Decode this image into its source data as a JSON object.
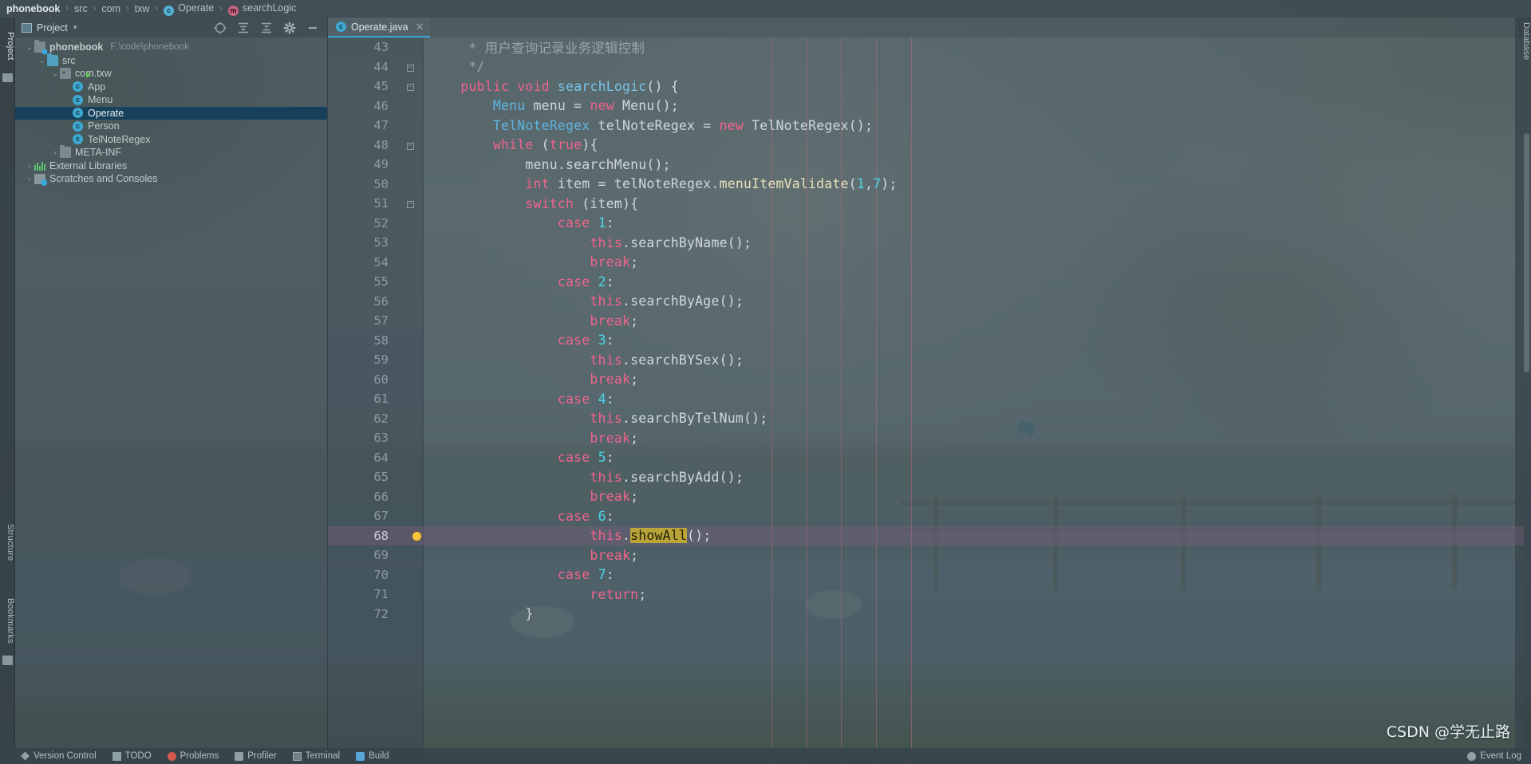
{
  "breadcrumb": {
    "items": [
      {
        "label": "phonebook",
        "icon": null,
        "bold": true
      },
      {
        "label": "src",
        "icon": null,
        "bold": false
      },
      {
        "label": "com",
        "icon": null,
        "bold": false
      },
      {
        "label": "txw",
        "icon": null,
        "bold": false
      },
      {
        "label": "Operate",
        "icon": "class-icon",
        "bold": false
      },
      {
        "label": "searchLogic",
        "icon": "method-icon",
        "bold": false
      }
    ],
    "separator": "›"
  },
  "left_strip": {
    "project_tab": "Project",
    "structure_tab": "Structure",
    "bookmarks_tab": "Bookmarks"
  },
  "right_strip": {
    "database_tab": "Database"
  },
  "project_panel": {
    "title": "Project",
    "caret": "▾",
    "toolbar": [
      {
        "name": "select-opened-file-icon",
        "glyph": "⊕"
      },
      {
        "name": "expand-all-icon",
        "glyph": "≡"
      },
      {
        "name": "collapse-all-icon",
        "glyph": "≡"
      },
      {
        "name": "settings-gear-icon",
        "glyph": "⚙"
      },
      {
        "name": "hide-panel-icon",
        "glyph": "−"
      }
    ],
    "tree": [
      {
        "label": "phonebook",
        "path": "F:\\code\\phonebook",
        "indent": 0,
        "arrow": "⌄",
        "icon": "module-folder",
        "selected": false
      },
      {
        "label": "src",
        "path": "",
        "indent": 1,
        "arrow": "⌄",
        "icon": "source-folder",
        "selected": false
      },
      {
        "label": "com.txw",
        "path": "",
        "indent": 2,
        "arrow": "⌄",
        "icon": "package",
        "selected": false
      },
      {
        "label": "App",
        "path": "",
        "indent": 3,
        "arrow": "",
        "icon": "class-runnable",
        "selected": false
      },
      {
        "label": "Menu",
        "path": "",
        "indent": 3,
        "arrow": "",
        "icon": "class",
        "selected": false
      },
      {
        "label": "Operate",
        "path": "",
        "indent": 3,
        "arrow": "",
        "icon": "class",
        "selected": true
      },
      {
        "label": "Person",
        "path": "",
        "indent": 3,
        "arrow": "",
        "icon": "class",
        "selected": false
      },
      {
        "label": "TelNoteRegex",
        "path": "",
        "indent": 3,
        "arrow": "",
        "icon": "class",
        "selected": false
      },
      {
        "label": "META-INF",
        "path": "",
        "indent": 2,
        "arrow": "›",
        "icon": "folder",
        "selected": false
      },
      {
        "label": "External Libraries",
        "path": "",
        "indent": 0,
        "arrow": "›",
        "icon": "libraries",
        "selected": false
      },
      {
        "label": "Scratches and Consoles",
        "path": "",
        "indent": 0,
        "arrow": "›",
        "icon": "scratches",
        "selected": false
      }
    ]
  },
  "editor": {
    "tab": {
      "label": "Operate.java",
      "icon": "class-icon",
      "close": "✕"
    },
    "lines": [
      {
        "n": 43,
        "fold": "",
        "bulb": false,
        "highlight": false,
        "tokens": [
          {
            "t": "   * 用户查询记录业务逻辑控制",
            "c": "cmt"
          }
        ]
      },
      {
        "n": 44,
        "fold": "box",
        "bulb": false,
        "highlight": false,
        "tokens": [
          {
            "t": "   */",
            "c": "cmt"
          }
        ]
      },
      {
        "n": 45,
        "fold": "boxend",
        "bulb": false,
        "highlight": false,
        "tokens": [
          {
            "t": "  ",
            "c": "pun"
          },
          {
            "t": "public",
            "c": "kw"
          },
          {
            "t": " ",
            "c": "pun"
          },
          {
            "t": "void",
            "c": "kw"
          },
          {
            "t": " ",
            "c": "pun"
          },
          {
            "t": "searchLogic",
            "c": "fn"
          },
          {
            "t": "() {",
            "c": "pun"
          }
        ]
      },
      {
        "n": 46,
        "fold": "",
        "bulb": false,
        "highlight": false,
        "tokens": [
          {
            "t": "      ",
            "c": "pun"
          },
          {
            "t": "Menu",
            "c": "type"
          },
          {
            "t": " menu = ",
            "c": "pun"
          },
          {
            "t": "new",
            "c": "kw"
          },
          {
            "t": " Menu();",
            "c": "pun"
          }
        ]
      },
      {
        "n": 47,
        "fold": "",
        "bulb": false,
        "highlight": false,
        "tokens": [
          {
            "t": "      ",
            "c": "pun"
          },
          {
            "t": "TelNoteRegex",
            "c": "type"
          },
          {
            "t": " telNoteRegex = ",
            "c": "pun"
          },
          {
            "t": "new",
            "c": "kw"
          },
          {
            "t": " TelNoteRegex();",
            "c": "pun"
          }
        ]
      },
      {
        "n": 48,
        "fold": "box",
        "bulb": false,
        "highlight": false,
        "tokens": [
          {
            "t": "      ",
            "c": "pun"
          },
          {
            "t": "while",
            "c": "kw"
          },
          {
            "t": " (",
            "c": "pun"
          },
          {
            "t": "true",
            "c": "kw"
          },
          {
            "t": "){",
            "c": "pun"
          }
        ]
      },
      {
        "n": 49,
        "fold": "",
        "bulb": false,
        "highlight": false,
        "tokens": [
          {
            "t": "          menu.searchMenu();",
            "c": "pun"
          }
        ]
      },
      {
        "n": 50,
        "fold": "",
        "bulb": false,
        "highlight": false,
        "tokens": [
          {
            "t": "          ",
            "c": "pun"
          },
          {
            "t": "int",
            "c": "kw"
          },
          {
            "t": " item = telNoteRegex.",
            "c": "pun"
          },
          {
            "t": "menuItemValidate",
            "c": "fncall"
          },
          {
            "t": "(",
            "c": "pun"
          },
          {
            "t": "1",
            "c": "num"
          },
          {
            "t": ",",
            "c": "pun"
          },
          {
            "t": "7",
            "c": "num"
          },
          {
            "t": ");",
            "c": "pun"
          }
        ]
      },
      {
        "n": 51,
        "fold": "box",
        "bulb": false,
        "highlight": false,
        "tokens": [
          {
            "t": "          ",
            "c": "pun"
          },
          {
            "t": "switch",
            "c": "kw"
          },
          {
            "t": " (item){",
            "c": "pun"
          }
        ]
      },
      {
        "n": 52,
        "fold": "",
        "bulb": false,
        "highlight": false,
        "tokens": [
          {
            "t": "              ",
            "c": "pun"
          },
          {
            "t": "case",
            "c": "kw"
          },
          {
            "t": " ",
            "c": "pun"
          },
          {
            "t": "1",
            "c": "num"
          },
          {
            "t": ":",
            "c": "pun"
          }
        ]
      },
      {
        "n": 53,
        "fold": "",
        "bulb": false,
        "highlight": false,
        "tokens": [
          {
            "t": "                  ",
            "c": "pun"
          },
          {
            "t": "this",
            "c": "this"
          },
          {
            "t": ".searchByName();",
            "c": "pun"
          }
        ]
      },
      {
        "n": 54,
        "fold": "",
        "bulb": false,
        "highlight": false,
        "tokens": [
          {
            "t": "                  ",
            "c": "pun"
          },
          {
            "t": "break",
            "c": "kw"
          },
          {
            "t": ";",
            "c": "pun"
          }
        ]
      },
      {
        "n": 55,
        "fold": "",
        "bulb": false,
        "highlight": false,
        "tokens": [
          {
            "t": "              ",
            "c": "pun"
          },
          {
            "t": "case",
            "c": "kw"
          },
          {
            "t": " ",
            "c": "pun"
          },
          {
            "t": "2",
            "c": "num"
          },
          {
            "t": ":",
            "c": "pun"
          }
        ]
      },
      {
        "n": 56,
        "fold": "",
        "bulb": false,
        "highlight": false,
        "tokens": [
          {
            "t": "                  ",
            "c": "pun"
          },
          {
            "t": "this",
            "c": "this"
          },
          {
            "t": ".searchByAge();",
            "c": "pun"
          }
        ]
      },
      {
        "n": 57,
        "fold": "",
        "bulb": false,
        "highlight": false,
        "tokens": [
          {
            "t": "                  ",
            "c": "pun"
          },
          {
            "t": "break",
            "c": "kw"
          },
          {
            "t": ";",
            "c": "pun"
          }
        ]
      },
      {
        "n": 58,
        "fold": "",
        "bulb": false,
        "highlight": false,
        "tokens": [
          {
            "t": "              ",
            "c": "pun"
          },
          {
            "t": "case",
            "c": "kw"
          },
          {
            "t": " ",
            "c": "pun"
          },
          {
            "t": "3",
            "c": "num"
          },
          {
            "t": ":",
            "c": "pun"
          }
        ]
      },
      {
        "n": 59,
        "fold": "",
        "bulb": false,
        "highlight": false,
        "tokens": [
          {
            "t": "                  ",
            "c": "pun"
          },
          {
            "t": "this",
            "c": "this"
          },
          {
            "t": ".searchBYSex();",
            "c": "pun"
          }
        ]
      },
      {
        "n": 60,
        "fold": "",
        "bulb": false,
        "highlight": false,
        "tokens": [
          {
            "t": "                  ",
            "c": "pun"
          },
          {
            "t": "break",
            "c": "kw"
          },
          {
            "t": ";",
            "c": "pun"
          }
        ]
      },
      {
        "n": 61,
        "fold": "",
        "bulb": false,
        "highlight": false,
        "tokens": [
          {
            "t": "              ",
            "c": "pun"
          },
          {
            "t": "case",
            "c": "kw"
          },
          {
            "t": " ",
            "c": "pun"
          },
          {
            "t": "4",
            "c": "num"
          },
          {
            "t": ":",
            "c": "pun"
          }
        ]
      },
      {
        "n": 62,
        "fold": "",
        "bulb": false,
        "highlight": false,
        "tokens": [
          {
            "t": "                  ",
            "c": "pun"
          },
          {
            "t": "this",
            "c": "this"
          },
          {
            "t": ".searchByTelNum();",
            "c": "pun"
          }
        ]
      },
      {
        "n": 63,
        "fold": "",
        "bulb": false,
        "highlight": false,
        "tokens": [
          {
            "t": "                  ",
            "c": "pun"
          },
          {
            "t": "break",
            "c": "kw"
          },
          {
            "t": ";",
            "c": "pun"
          }
        ]
      },
      {
        "n": 64,
        "fold": "",
        "bulb": false,
        "highlight": false,
        "tokens": [
          {
            "t": "              ",
            "c": "pun"
          },
          {
            "t": "case",
            "c": "kw"
          },
          {
            "t": " ",
            "c": "pun"
          },
          {
            "t": "5",
            "c": "num"
          },
          {
            "t": ":",
            "c": "pun"
          }
        ]
      },
      {
        "n": 65,
        "fold": "",
        "bulb": false,
        "highlight": false,
        "tokens": [
          {
            "t": "                  ",
            "c": "pun"
          },
          {
            "t": "this",
            "c": "this"
          },
          {
            "t": ".searchByAdd();",
            "c": "pun"
          }
        ]
      },
      {
        "n": 66,
        "fold": "",
        "bulb": false,
        "highlight": false,
        "tokens": [
          {
            "t": "                  ",
            "c": "pun"
          },
          {
            "t": "break",
            "c": "kw"
          },
          {
            "t": ";",
            "c": "pun"
          }
        ]
      },
      {
        "n": 67,
        "fold": "",
        "bulb": false,
        "highlight": false,
        "tokens": [
          {
            "t": "              ",
            "c": "pun"
          },
          {
            "t": "case",
            "c": "kw"
          },
          {
            "t": " ",
            "c": "pun"
          },
          {
            "t": "6",
            "c": "num"
          },
          {
            "t": ":",
            "c": "pun"
          }
        ]
      },
      {
        "n": 68,
        "fold": "",
        "bulb": true,
        "highlight": true,
        "tokens": [
          {
            "t": "                  ",
            "c": "pun"
          },
          {
            "t": "this",
            "c": "this"
          },
          {
            "t": ".",
            "c": "pun"
          },
          {
            "t": "showAll",
            "c": "hl-word"
          },
          {
            "t": "();",
            "c": "pun"
          }
        ]
      },
      {
        "n": 69,
        "fold": "",
        "bulb": false,
        "highlight": false,
        "tokens": [
          {
            "t": "                  ",
            "c": "pun"
          },
          {
            "t": "break",
            "c": "kw"
          },
          {
            "t": ";",
            "c": "pun"
          }
        ]
      },
      {
        "n": 70,
        "fold": "",
        "bulb": false,
        "highlight": false,
        "tokens": [
          {
            "t": "              ",
            "c": "pun"
          },
          {
            "t": "case",
            "c": "kw"
          },
          {
            "t": " ",
            "c": "pun"
          },
          {
            "t": "7",
            "c": "num"
          },
          {
            "t": ":",
            "c": "pun"
          }
        ]
      },
      {
        "n": 71,
        "fold": "",
        "bulb": false,
        "highlight": false,
        "tokens": [
          {
            "t": "                  ",
            "c": "pun"
          },
          {
            "t": "return",
            "c": "kw"
          },
          {
            "t": ";",
            "c": "pun"
          }
        ]
      },
      {
        "n": 72,
        "fold": "",
        "bulb": false,
        "highlight": false,
        "tokens": [
          {
            "t": "          }",
            "c": "pun"
          }
        ]
      }
    ]
  },
  "statusbar": {
    "items": [
      {
        "label": "Version Control",
        "icon": "version-control-icon"
      },
      {
        "label": "TODO",
        "icon": "todo-icon"
      },
      {
        "label": "Problems",
        "icon": "problems-icon"
      },
      {
        "label": "Profiler",
        "icon": "profiler-icon"
      },
      {
        "label": "Terminal",
        "icon": "terminal-icon"
      },
      {
        "label": "Build",
        "icon": "build-icon"
      }
    ],
    "right": [
      {
        "label": "Event Log",
        "icon": "event-log-icon"
      }
    ]
  },
  "watermark": "CSDN @学无止路",
  "colors": {
    "accent": "#3ba6dd",
    "selection": "#16405c",
    "keyword": "#f0648c",
    "type": "#5fb4e0",
    "number": "#4ad7e8",
    "highlight_bg": "#b9a43a",
    "line_highlight": "rgba(131,94,128,0.34)"
  }
}
